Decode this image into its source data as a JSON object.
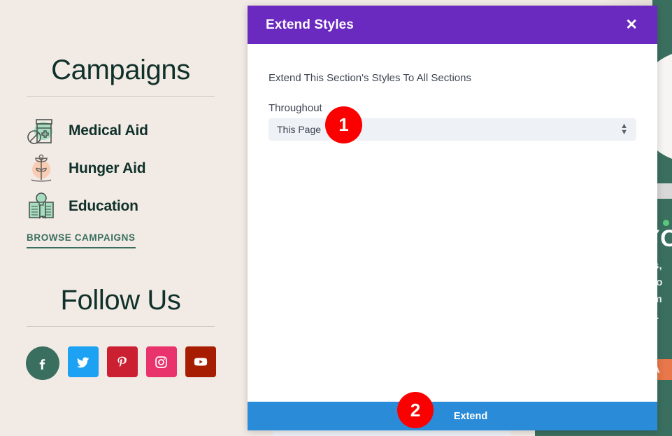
{
  "modal": {
    "title": "Extend Styles",
    "close_icon": "close-icon",
    "description": "Extend This Section's Styles To All Sections",
    "field_label": "Throughout",
    "select_value": "This Page",
    "select_options": [
      "This Page"
    ],
    "select_icon": "up-down-arrows-icon",
    "footer_button": "Extend",
    "header_color": "#6a29bf",
    "footer_color": "#2a8cd8"
  },
  "badges": [
    {
      "number": "1"
    },
    {
      "number": "2"
    }
  ],
  "sidebar": {
    "campaigns_title": "Campaigns",
    "campaigns": [
      {
        "label": "Medical Aid",
        "icon": "pill-bottle-icon"
      },
      {
        "label": "Hunger Aid",
        "icon": "sprout-icon"
      },
      {
        "label": "Education",
        "icon": "open-book-lightbulb-icon"
      }
    ],
    "browse_link": "BROWSE CAMPAIGNS",
    "follow_title": "Follow Us",
    "social": [
      {
        "name": "facebook",
        "glyph": "f",
        "color": "#3a6f5f"
      },
      {
        "name": "twitter",
        "glyph": "twitter-bird-icon",
        "color": "#1da1f2"
      },
      {
        "name": "pinterest",
        "glyph": "P",
        "color": "#cb1f32"
      },
      {
        "name": "instagram",
        "glyph": "instagram-camera-icon",
        "color": "#e8336d"
      },
      {
        "name": "youtube",
        "glyph": "youtube-play-icon",
        "color": "#a71d02"
      }
    ],
    "heading_color": "#10312b",
    "accent_color": "#3a6f5f"
  },
  "hero": {
    "heading_fragment": "YO",
    "body_fragments": [
      "us,",
      "n o",
      "em",
      "m."
    ],
    "cta_fragment": "DA",
    "background_color": "#3a6f5f",
    "cta_color": "#e8774a"
  }
}
